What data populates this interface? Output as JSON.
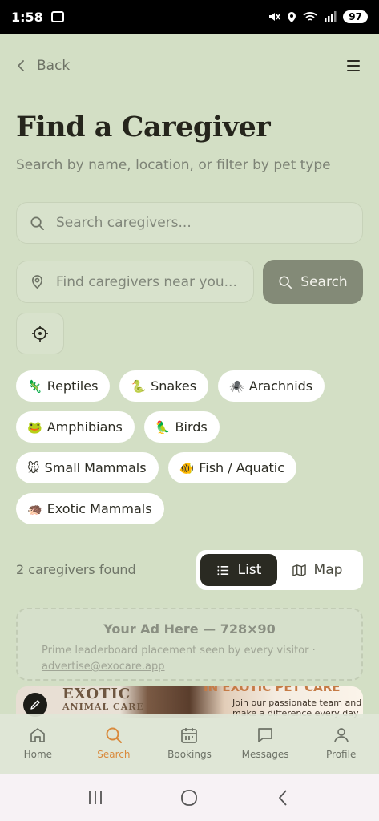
{
  "status_bar": {
    "time": "1:58",
    "battery": "97"
  },
  "nav": {
    "back_label": "Back"
  },
  "page": {
    "title": "Find a Caregiver",
    "subtitle": "Search by name, location, or filter by pet type"
  },
  "search": {
    "name_placeholder": "Search caregivers...",
    "location_placeholder": "Find caregivers near you...",
    "button_label": "Search"
  },
  "chips": [
    {
      "emoji": "🦎",
      "label": "Reptiles"
    },
    {
      "emoji": "🐍",
      "label": "Snakes"
    },
    {
      "emoji": "🕷️",
      "label": "Arachnids"
    },
    {
      "emoji": "🐸",
      "label": "Amphibians"
    },
    {
      "emoji": "🦜",
      "label": "Birds"
    },
    {
      "emoji": "🐭",
      "label": "Small Mammals"
    },
    {
      "emoji": "🐠",
      "label": "Fish / Aquatic"
    },
    {
      "emoji": "🦔",
      "label": "Exotic Mammals"
    }
  ],
  "results": {
    "count_text": "2 caregivers found"
  },
  "view_toggle": {
    "list_label": "List",
    "map_label": "Map",
    "active": "List"
  },
  "ad": {
    "title": "Your Ad Here — 728×90",
    "description": "Prime leaderboard placement seen by every visitor ·",
    "email": "advertise@exocare.app"
  },
  "card": {
    "brand_line1": "EXOTIC",
    "brand_line2": "ANIMAL CARE",
    "headline": "IN EXOTIC PET CARE",
    "copy_line1": "Join our passionate team and",
    "copy_line2": "make a difference every day"
  },
  "tabs": [
    {
      "label": "Home",
      "icon": "home-icon"
    },
    {
      "label": "Search",
      "icon": "search-icon",
      "active": true
    },
    {
      "label": "Bookings",
      "icon": "calendar-icon"
    },
    {
      "label": "Messages",
      "icon": "message-icon"
    },
    {
      "label": "Profile",
      "icon": "person-icon"
    }
  ],
  "colors": {
    "background": "#d3dfc5",
    "accent": "#d98a3d",
    "dark": "#2a2a22",
    "search_button": "#838a77"
  }
}
